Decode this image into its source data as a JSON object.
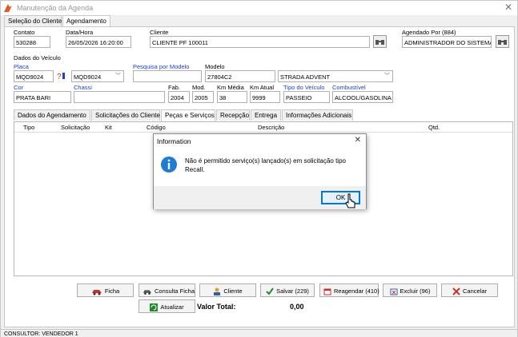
{
  "window": {
    "title": "Manutenção da Agenda",
    "close_glyph": "✕"
  },
  "top_tabs": [
    "Seleção do Cliente",
    "Agendamento"
  ],
  "contato": {
    "label": "Contato",
    "value": "530288"
  },
  "datahora": {
    "label": "Data/Hora",
    "value": "26/05/2026 16:20:00"
  },
  "cliente": {
    "label": "Cliente",
    "value": "CLIENTE PF 100011"
  },
  "agendado": {
    "label": "Agendado Por (884)",
    "value": "ADMINISTRADOR DO SISTEMA"
  },
  "veiculo": {
    "section": "Dados do Veículo",
    "placa_label": "Placa",
    "placa": "MQD9024",
    "placa2": "MQD9024",
    "pesquisa_label": "Pesquisa por Modelo",
    "pesquisa": "",
    "modelo_label": "Modelo",
    "modelo_code": "27804C2",
    "modelo_name": "STRADA ADVENT",
    "cor_label": "Cor",
    "cor": "PRATA BARI",
    "chassi_label": "Chassi",
    "chassi": "",
    "fab_label": "Fab.",
    "fab": "2004",
    "mod_label": "Mod.",
    "mod": "2005",
    "kmmedia_label": "Km Média",
    "kmmedia": "38",
    "kmatual_label": "Km Atual",
    "kmatual": "9999",
    "tipo_label": "Tipo do Veículo",
    "tipo": "PASSEIO",
    "comb_label": "Combustível",
    "comb": "ALCOOL/GASOLINA"
  },
  "inner_tabs": [
    "Dados do Agendamento",
    "Solicitações do Cliente",
    "Peças e Serviços",
    "Recepção",
    "Entrega",
    "Informações Adicionais"
  ],
  "grid_columns": [
    "Tipo",
    "Solicitação",
    "Kit",
    "Código",
    "Descrição",
    "Qtd."
  ],
  "buttons": {
    "ficha": "Ficha",
    "consulta": "Consulta Ficha",
    "cliente": "Cliente",
    "salvar": "Salvar (229)",
    "reagendar": "Reagendar (410)",
    "excluir": "Excluir (96)",
    "cancelar": "Cancelar",
    "atualizar": "Atualizar"
  },
  "total": {
    "label": "Valor Total:",
    "value": "0,00"
  },
  "status": "CONSULTOR: VENDEDOR 1",
  "dialog": {
    "title": "Information",
    "message": "Não é permitido serviço(s) lançado(s) em solicitação tipo Recall.",
    "ok": "OK",
    "close_glyph": "✕"
  },
  "colors": {
    "accent": "#0078d7",
    "label_blue": "#1d3fd1",
    "info_icon": "#1e7bd6"
  }
}
